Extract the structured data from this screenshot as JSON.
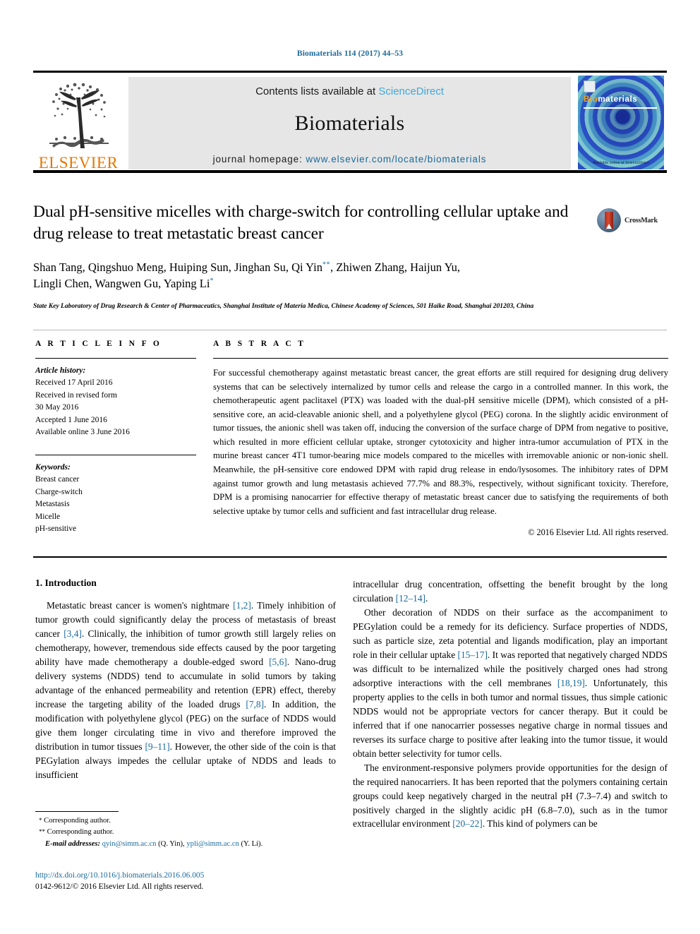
{
  "running_head": "Biomaterials 114 (2017) 44–53",
  "masthead": {
    "publisher_name": "ELSEVIER",
    "contents_prefix": "Contents lists available at ",
    "contents_link": "ScienceDirect",
    "journal_name": "Biomaterials",
    "homepage_prefix": "journal homepage: ",
    "homepage_url": "www.elsevier.com/locate/biomaterials",
    "cover_title_bio": "Bio",
    "cover_title_materials": "materials",
    "cover_footer": "Available online at\nScienceDirect"
  },
  "title": "Dual pH-sensitive micelles with charge-switch for controlling cellular uptake and drug release to treat metastatic breast cancer",
  "authors_line1": "Shan Tang, Qingshuo Meng, Huiping Sun, Jinghan Su, Qi Yin",
  "authors_mark1": "**",
  "authors_line1b": ", Zhiwen Zhang, Haijun Yu,",
  "authors_line2": "Lingli Chen, Wangwen Gu, Yaping Li",
  "authors_mark2": "*",
  "affiliation": "State Key Laboratory of Drug Research & Center of Pharmaceutics, Shanghai Institute of Materia Medica, Chinese Academy of Sciences, 501 Haike Road, Shanghai 201203, China",
  "crossmark_label": "CrossMark",
  "article_info": {
    "heading": "A R T I C L E   I N F O",
    "history_label": "Article history:",
    "history": [
      "Received 17 April 2016",
      "Received in revised form",
      "30 May 2016",
      "Accepted 1 June 2016",
      "Available online 3 June 2016"
    ],
    "keywords_label": "Keywords:",
    "keywords": [
      "Breast cancer",
      "Charge-switch",
      "Metastasis",
      "Micelle",
      "pH-sensitive"
    ]
  },
  "abstract": {
    "heading": "A B S T R A C T",
    "text": "For successful chemotherapy against metastatic breast cancer, the great efforts are still required for designing drug delivery systems that can be selectively internalized by tumor cells and release the cargo in a controlled manner. In this work, the chemotherapeutic agent paclitaxel (PTX) was loaded with the dual-pH sensitive micelle (DPM), which consisted of a pH-sensitive core, an acid-cleavable anionic shell, and a polyethylene glycol (PEG) corona. In the slightly acidic environment of tumor tissues, the anionic shell was taken off, inducing the conversion of the surface charge of DPM from negative to positive, which resulted in more efficient cellular uptake, stronger cytotoxicity and higher intra-tumor accumulation of PTX in the murine breast cancer 4T1 tumor-bearing mice models compared to the micelles with irremovable anionic or non-ionic shell. Meanwhile, the pH-sensitive core endowed DPM with rapid drug release in endo/lysosomes. The inhibitory rates of DPM against tumor growth and lung metastasis achieved 77.7% and 88.3%, respectively, without significant toxicity. Therefore, DPM is a promising nanocarrier for effective therapy of metastatic breast cancer due to satisfying the requirements of both selective uptake by tumor cells and sufficient and fast intracellular drug release.",
    "copyright": "© 2016 Elsevier Ltd. All rights reserved."
  },
  "introduction": {
    "heading": "1. Introduction",
    "left_paragraphs": [
      "Metastatic breast cancer is women's nightmare [1,2]. Timely inhibition of tumor growth could significantly delay the process of metastasis of breast cancer [3,4]. Clinically, the inhibition of tumor growth still largely relies on chemotherapy, however, tremendous side effects caused by the poor targeting ability have made chemotherapy a double-edged sword [5,6]. Nano-drug delivery systems (NDDS) tend to accumulate in solid tumors by taking advantage of the enhanced permeability and retention (EPR) effect, thereby increase the targeting ability of the loaded drugs [7,8]. In addition, the modification with polyethylene glycol (PEG) on the surface of NDDS would give them longer circulating time in vivo and therefore improved the distribution in tumor tissues [9–11]. However, the other side of the coin is that PEGylation always impedes the cellular uptake of NDDS and leads to insufficient"
    ],
    "right_paragraphs": [
      "intracellular drug concentration, offsetting the benefit brought by the long circulation [12–14].",
      "Other decoration of NDDS on their surface as the accompaniment to PEGylation could be a remedy for its deficiency. Surface properties of NDDS, such as particle size, zeta potential and ligands modification, play an important role in their cellular uptake [15–17]. It was reported that negatively charged NDDS was difficult to be internalized while the positively charged ones had strong adsorptive interactions with the cell membranes [18,19]. Unfortunately, this property applies to the cells in both tumor and normal tissues, thus simple cationic NDDS would not be appropriate vectors for cancer therapy. But it could be inferred that if one nanocarrier possesses negative charge in normal tissues and reverses its surface charge to positive after leaking into the tumor tissue, it would obtain better selectivity for tumor cells.",
      "The environment-responsive polymers provide opportunities for the design of the required nanocarriers. It has been reported that the polymers containing certain groups could keep negatively charged in the neutral pH (7.3–7.4) and switch to positively charged in the slightly acidic pH (6.8–7.0), such as in the tumor extracellular environment [20–22]. This kind of polymers can be"
    ]
  },
  "footnotes": {
    "corresponding1_mark": "*",
    "corresponding1": "Corresponding author.",
    "corresponding2_mark": "**",
    "corresponding2": "Corresponding author.",
    "email_label": "E-mail addresses:",
    "email1": "qyin@simm.ac.cn",
    "email1_owner": "(Q. Yin),",
    "email2": "ypli@simm.ac.cn",
    "email2_owner": "(Y. Li)."
  },
  "doi": "http://dx.doi.org/10.1016/j.biomaterials.2016.06.005",
  "issn_line": "0142-9612/© 2016 Elsevier Ltd. All rights reserved.",
  "colors": {
    "link_blue": "#1a6a9b",
    "sciencedirect_blue": "#3fa9d8",
    "elsevier_orange": "#E77600",
    "cover_orange": "#f0a31e"
  }
}
